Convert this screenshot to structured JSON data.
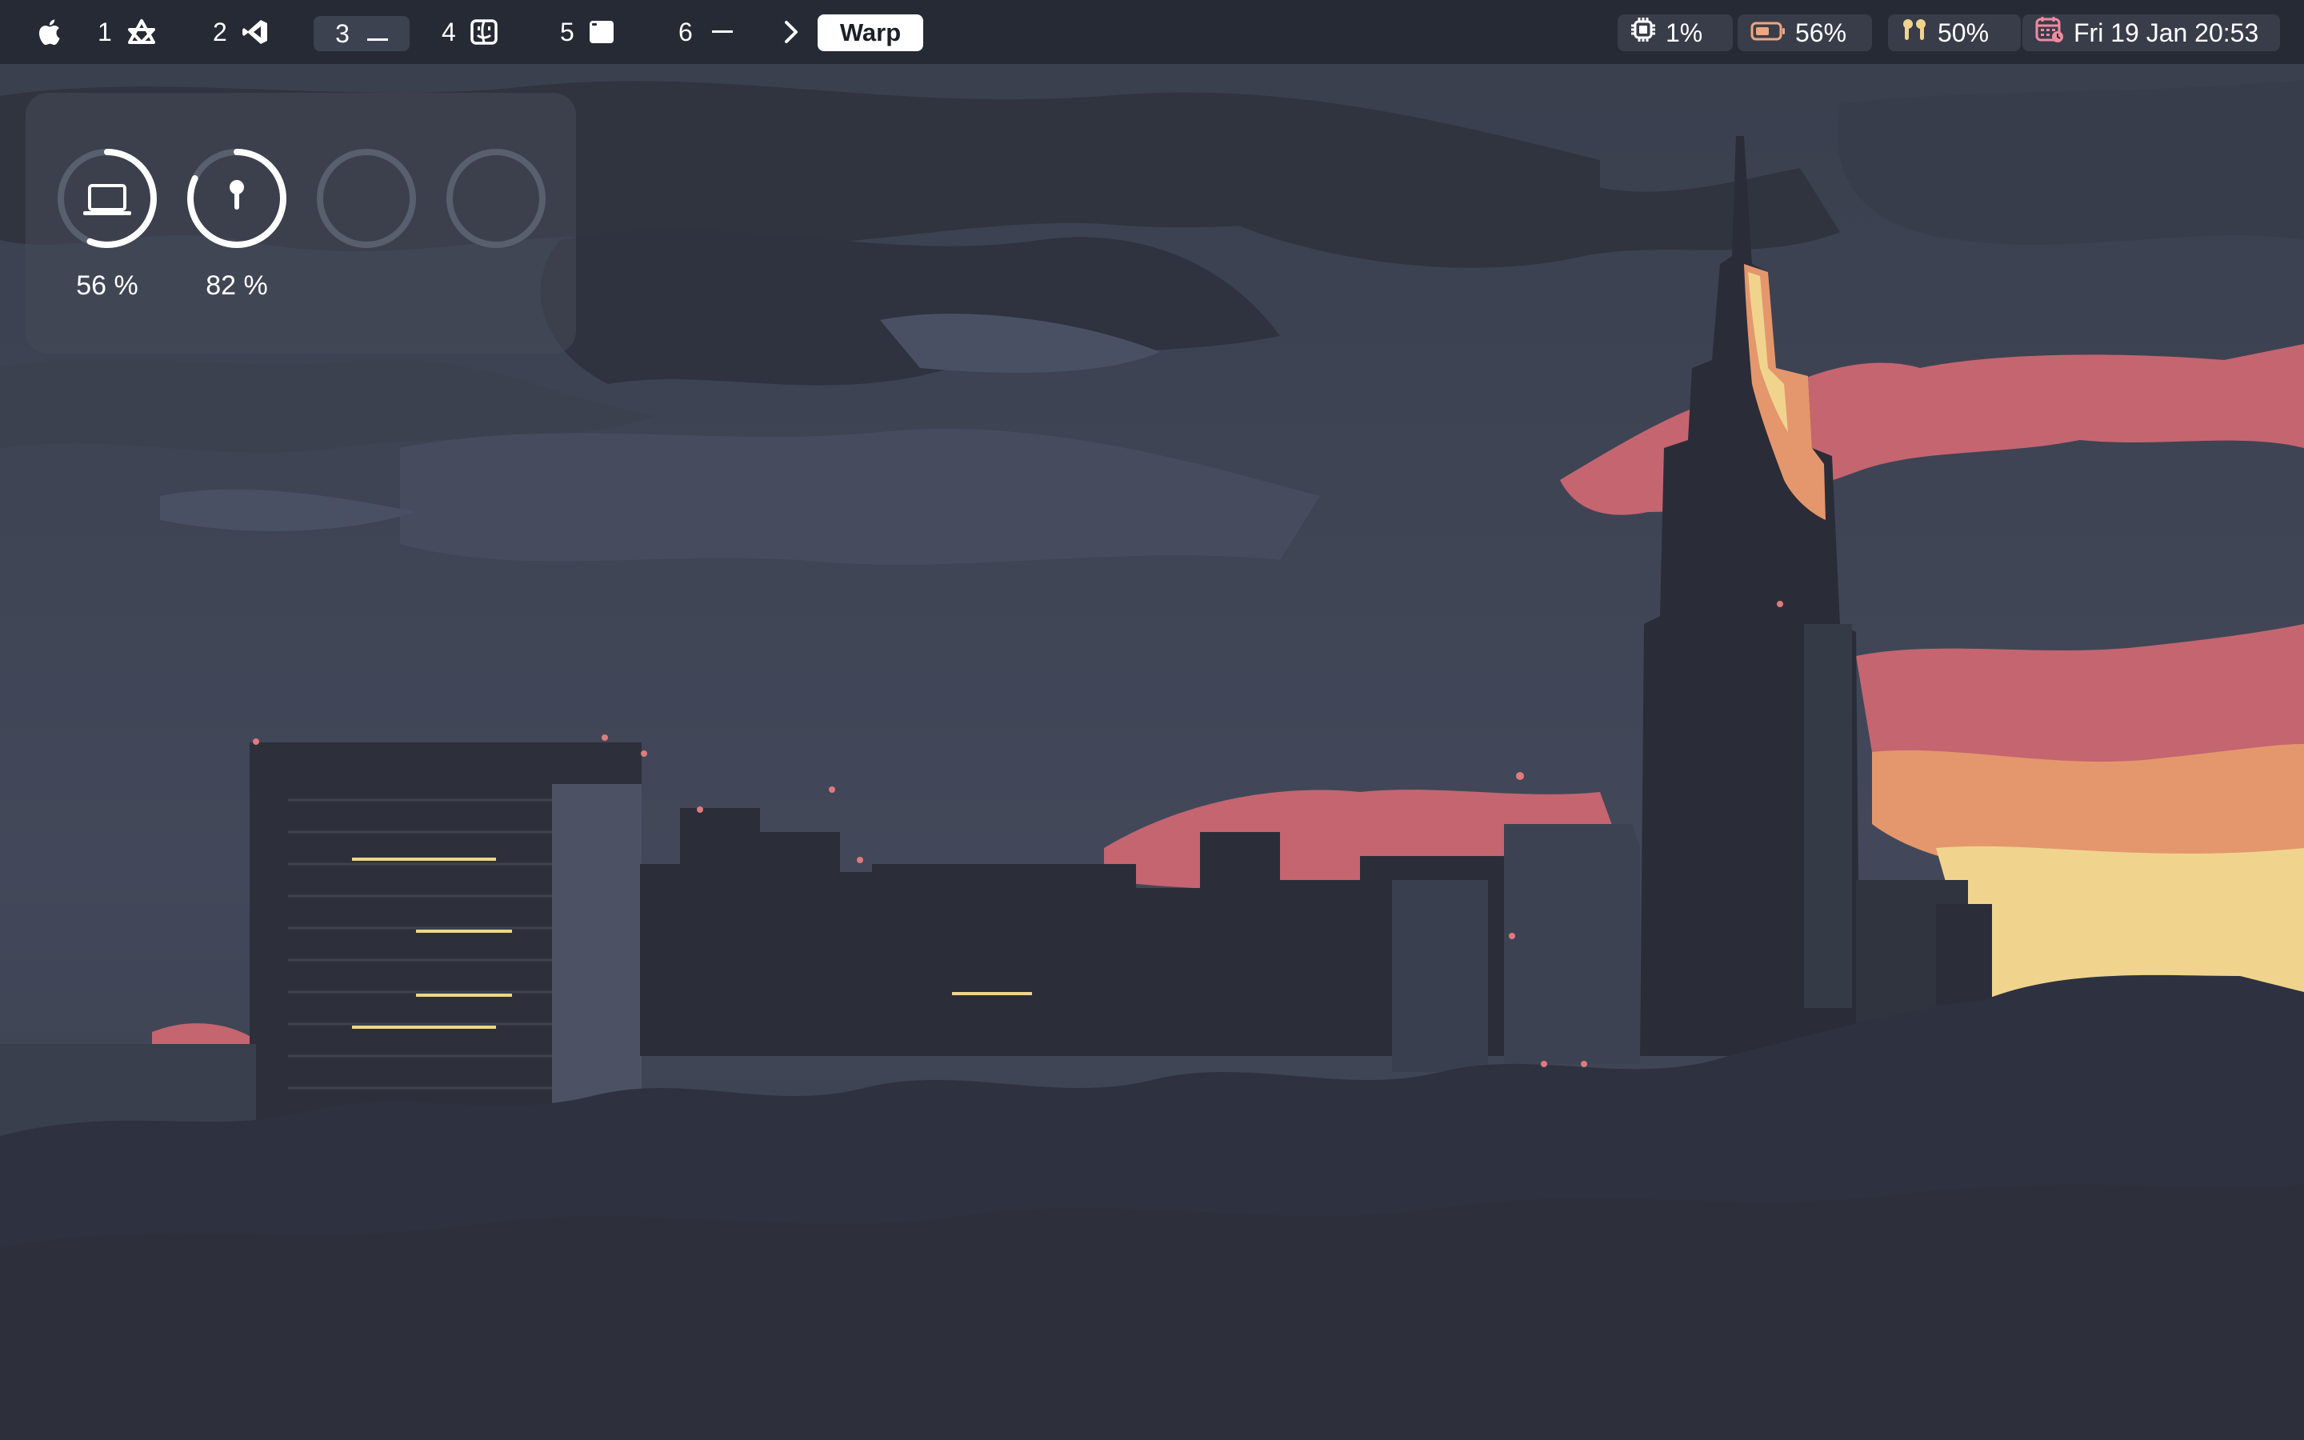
{
  "menubar": {
    "apple_icon": "apple-logo-icon",
    "spaces": [
      {
        "number": "1",
        "icon": "affinity-icon"
      },
      {
        "number": "2",
        "icon": "vscode-icon"
      },
      {
        "number": "3",
        "icon": "dash-icon",
        "active": true
      },
      {
        "number": "4",
        "icon": "finder-icon"
      },
      {
        "number": "5",
        "icon": "window-icon"
      },
      {
        "number": "6",
        "icon": "dash-icon"
      }
    ],
    "arrow_icon": "chevron-right-icon",
    "active_app": "Warp",
    "status": {
      "cpu": {
        "icon": "cpu-icon",
        "value": "1%"
      },
      "battery": {
        "icon": "battery-icon",
        "value": "56%"
      },
      "airpods": {
        "icon": "airpods-icon",
        "value": "50%"
      },
      "clock": {
        "icon": "calendar-icon",
        "value": "Fri 19 Jan 20:53"
      }
    }
  },
  "battery_widget": {
    "devices": [
      {
        "icon": "laptop-icon",
        "label": "56 %",
        "level": 0.56
      },
      {
        "icon": "airpod-icon",
        "label": "82 %",
        "level": 0.82
      },
      {
        "icon": "",
        "label": "",
        "level": 0
      },
      {
        "icon": "",
        "label": "",
        "level": 0
      }
    ]
  },
  "colors": {
    "menubar_bg": "#252832",
    "accent_text": "#ffffff",
    "battery_accent": "#f0a57c",
    "calendar_accent": "#f08aa0",
    "sky_dark": "#2f333f",
    "sky_mid": "#4a5064",
    "sunset_red": "#c56570",
    "sunset_orange": "#e4976d",
    "sunset_yellow": "#f0d48e"
  }
}
